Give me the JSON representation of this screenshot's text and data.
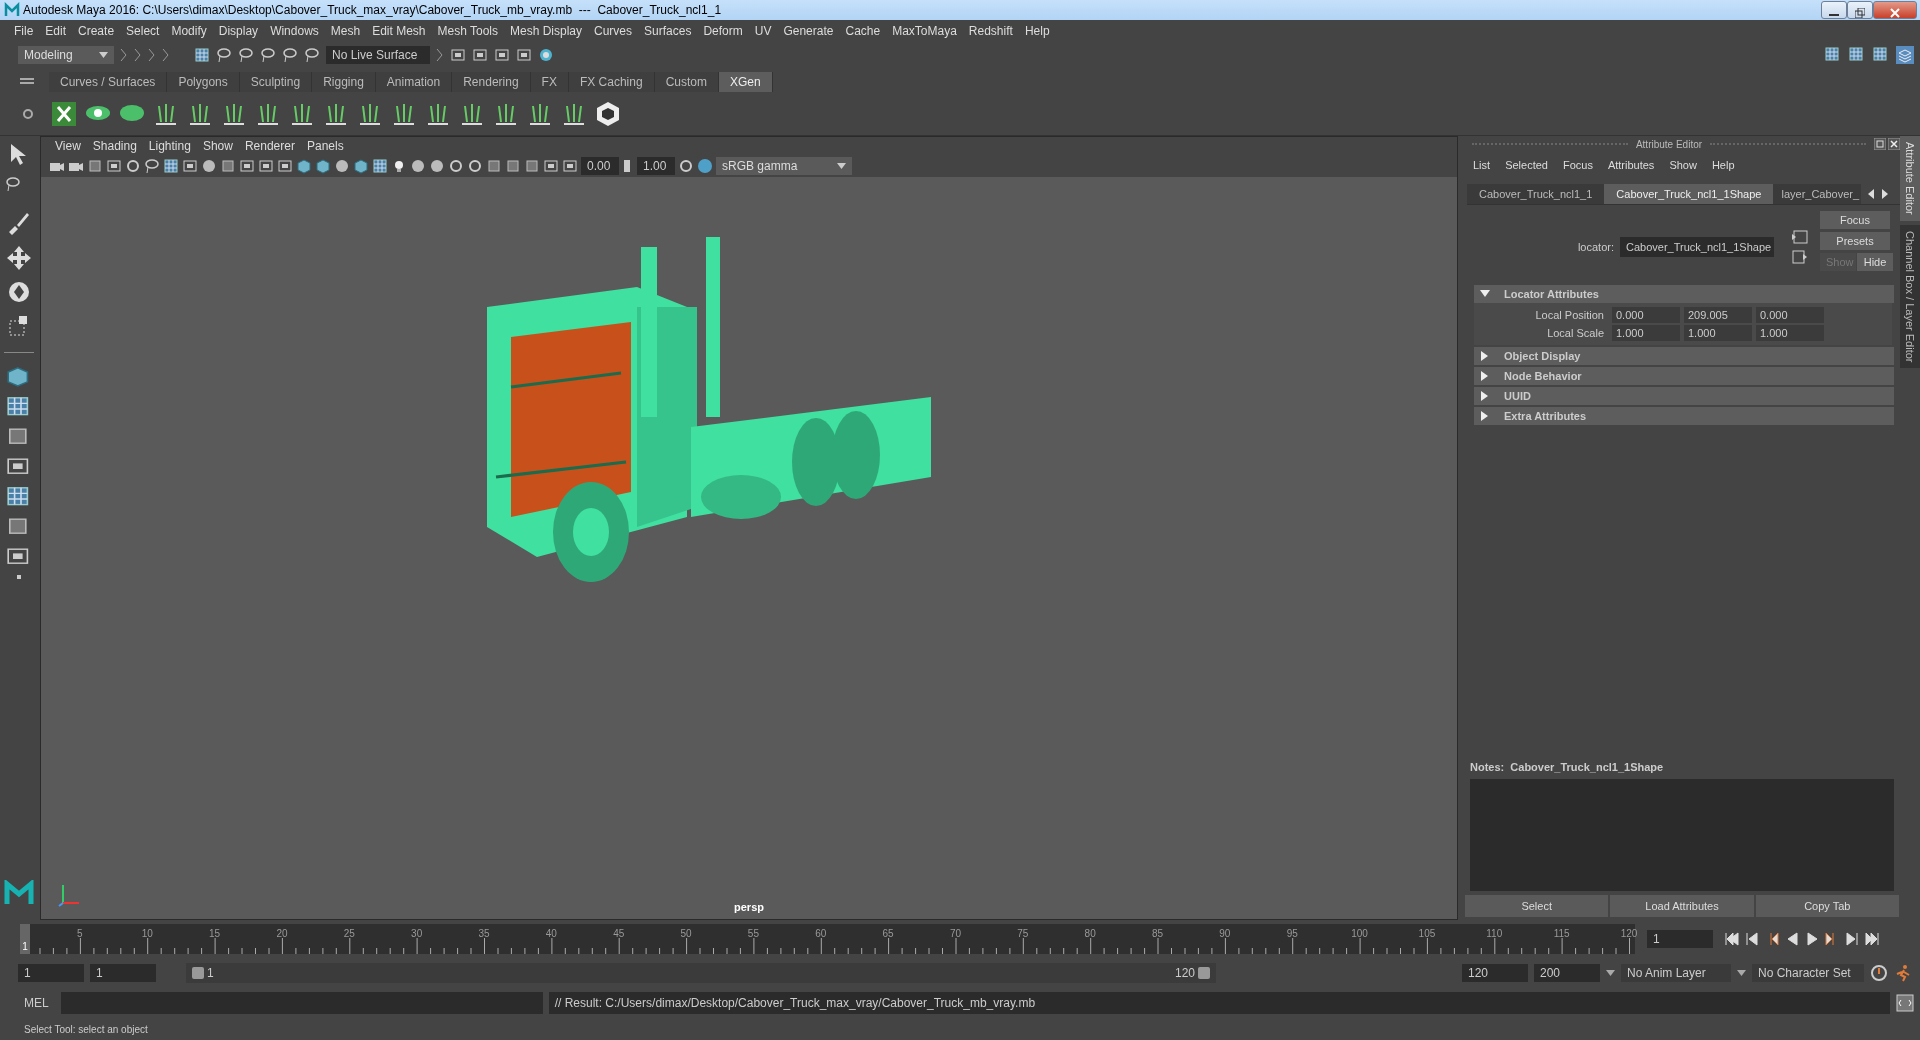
{
  "window": {
    "title": "Autodesk Maya 2016: C:\\Users\\dimax\\Desktop\\Cabover_Truck_max_vray\\Cabover_Truck_mb_vray.mb  ---  Cabover_Truck_ncl1_1"
  },
  "menu_bar": [
    "File",
    "Edit",
    "Create",
    "Select",
    "Modify",
    "Display",
    "Windows",
    "Mesh",
    "Edit Mesh",
    "Mesh Tools",
    "Mesh Display",
    "Curves",
    "Surfaces",
    "Deform",
    "UV",
    "Generate",
    "Cache",
    "MaxToMaya",
    "Redshift",
    "Help"
  ],
  "status_line": {
    "menu_set": "Modeling",
    "live_surface": "No Live Surface"
  },
  "shelf": {
    "tabs": [
      {
        "label": "Curves / Surfaces",
        "selected": false
      },
      {
        "label": "Polygons",
        "selected": false
      },
      {
        "label": "Sculpting",
        "selected": false
      },
      {
        "label": "Rigging",
        "selected": false
      },
      {
        "label": "Animation",
        "selected": false
      },
      {
        "label": "Rendering",
        "selected": false
      },
      {
        "label": "FX",
        "selected": false
      },
      {
        "label": "FX Caching",
        "selected": false
      },
      {
        "label": "Custom",
        "selected": false
      },
      {
        "label": "XGen",
        "selected": true
      }
    ]
  },
  "viewport": {
    "menus": [
      "View",
      "Shading",
      "Lighting",
      "Show",
      "Renderer",
      "Panels"
    ],
    "exposure": "0.00",
    "gamma": "1.00",
    "color_space": "sRGB gamma",
    "camera": "persp"
  },
  "attribute_editor": {
    "title": "Attribute Editor",
    "menus": [
      "List",
      "Selected",
      "Focus",
      "Attributes",
      "Show",
      "Help"
    ],
    "tabs": [
      {
        "label": "Cabover_Truck_ncl1_1",
        "selected": false
      },
      {
        "label": "Cabover_Truck_ncl1_1Shape",
        "selected": true
      },
      {
        "label": "layer_Cabover_",
        "selected": false
      }
    ],
    "locator_label": "locator:",
    "locator_value": "Cabover_Truck_ncl1_1Shape",
    "buttons": [
      "Focus",
      "Presets"
    ],
    "show_hide": [
      {
        "label": "Show",
        "disabled": true
      },
      {
        "label": "Hide",
        "disabled": false
      }
    ],
    "sections": [
      {
        "label": "Locator Attributes",
        "expanded": true,
        "rows": [
          {
            "label": "Local Position",
            "values": [
              "0.000",
              "209.005",
              "0.000"
            ]
          },
          {
            "label": "Local Scale",
            "values": [
              "1.000",
              "1.000",
              "1.000"
            ]
          }
        ]
      },
      {
        "label": "Object Display",
        "expanded": false
      },
      {
        "label": "Node Behavior",
        "expanded": false
      },
      {
        "label": "UUID",
        "expanded": false
      },
      {
        "label": "Extra Attributes",
        "expanded": false
      }
    ],
    "notes_label": "Notes:  Cabover_Truck_ncl1_1Shape",
    "footer_buttons": [
      "Select",
      "Load Attributes",
      "Copy Tab"
    ]
  },
  "side_tabs": [
    {
      "label": "Attribute Editor",
      "selected": true
    },
    {
      "label": "Channel Box / Layer Editor",
      "selected": false
    }
  ],
  "time_slider": {
    "ticks": [
      "5",
      "10",
      "15",
      "20",
      "25",
      "30",
      "35",
      "40",
      "45",
      "50",
      "55",
      "60",
      "65",
      "70",
      "75",
      "80",
      "85",
      "90",
      "95",
      "100",
      "105",
      "110",
      "115",
      "120"
    ],
    "current_frame_marker": "1",
    "current_frame": "1"
  },
  "range_slider": {
    "start": "1",
    "playback_start": "1",
    "range_start": "1",
    "range_end": "120",
    "playback_end": "120",
    "end": "200",
    "anim_layer": "No Anim Layer",
    "character_set": "No Character Set"
  },
  "command_line": {
    "language": "MEL",
    "result": "// Result: C:/Users/dimax/Desktop/Cabover_Truck_max_vray/Cabover_Truck_mb_vray.mb"
  },
  "help_line": "Select Tool: select an object"
}
